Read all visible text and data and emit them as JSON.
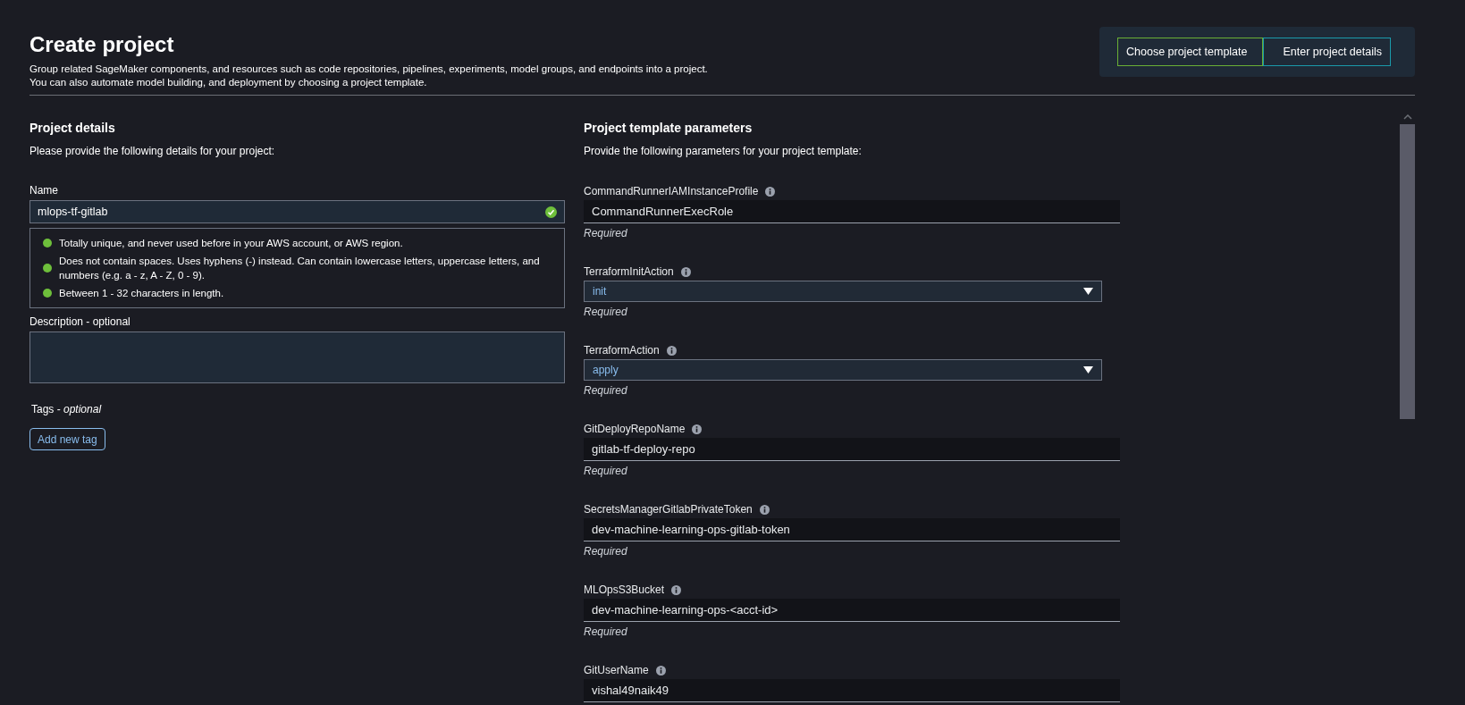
{
  "header": {
    "title": "Create project",
    "description": "Group related SageMaker components, and resources such as code repositories, pipelines, experiments, model groups, and endpoints into a project. You can also automate model building, and deployment by choosing a project template."
  },
  "steps": [
    {
      "label": "Choose project template",
      "selected": false
    },
    {
      "label": "Enter project details",
      "selected": true
    }
  ],
  "project_details": {
    "title": "Project details",
    "subtitle": "Please provide the following details for your project:",
    "name_label": "Name",
    "name_value": "mlops-tf-gitlab",
    "name_valid": true,
    "rules": [
      {
        "text": "Totally unique, and never used before in your AWS account, or AWS region.",
        "met": true
      },
      {
        "text": "Does not contain spaces. Uses hyphens (-) instead. Can contain lowercase letters, uppercase letters, and numbers (e.g. a - z, A - Z, 0 - 9).",
        "met": true
      },
      {
        "text": "Between 1 - 32 characters in length.",
        "met": true
      }
    ],
    "description_label": "Description - optional",
    "tags_label": "Tags - *optional*",
    "add_tag_button": "Add new tag"
  },
  "template_parameters": {
    "title": "Project template parameters",
    "subtitle": "Provide the following parameters for your project template:",
    "params": [
      {
        "kind": "text",
        "label": "CommandRunnerIAMInstanceProfile",
        "value": "CommandRunnerExecRole",
        "hint": "Required"
      },
      {
        "kind": "select",
        "label": "TerraformInitAction",
        "value": "init",
        "hint": "Required"
      },
      {
        "kind": "select",
        "label": "TerraformAction",
        "value": "apply",
        "hint": "Required"
      },
      {
        "kind": "text",
        "label": "GitDeployRepoName",
        "value": "gitlab-tf-deploy-repo",
        "hint": "Required"
      },
      {
        "kind": "text",
        "label": "SecretsManagerGitlabPrivateToken",
        "value": "dev-machine-learning-ops-gitlab-token",
        "hint": "Required"
      },
      {
        "kind": "text",
        "label": "MLOpsS3Bucket",
        "value": "dev-machine-learning-ops-<acct-id>",
        "hint": "Required"
      },
      {
        "kind": "text",
        "label": "GitUserName",
        "value": "vishal49naik49"
      }
    ]
  }
}
